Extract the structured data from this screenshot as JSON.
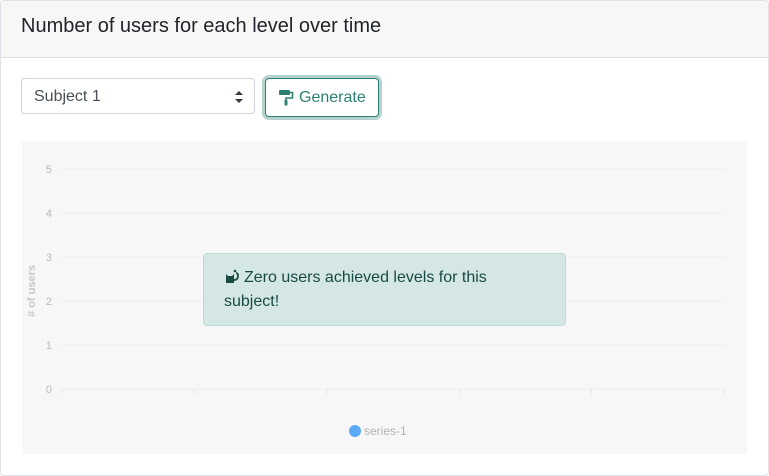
{
  "card": {
    "title": "Number of users for each level over time"
  },
  "controls": {
    "subject_select": {
      "selected": "Subject 1"
    },
    "generate_button": {
      "label": "Generate"
    }
  },
  "alert": {
    "message": "Zero users achieved levels for this subject!",
    "color": "#d4e7e4"
  },
  "icons": {
    "generate": "paint-roller-icon",
    "alert": "cat-icon"
  },
  "chart_data": {
    "type": "line",
    "ylabel": "# of users",
    "xlabel": "",
    "ylim": [
      0,
      5
    ],
    "yticks": [
      0,
      1,
      2,
      3,
      4,
      5
    ],
    "grid": true,
    "series": [
      {
        "name": "series-1",
        "values": [],
        "color": "#5aaaf7"
      }
    ],
    "legend": "bottom-center"
  },
  "colors": {
    "accent": "#2c7f73"
  }
}
